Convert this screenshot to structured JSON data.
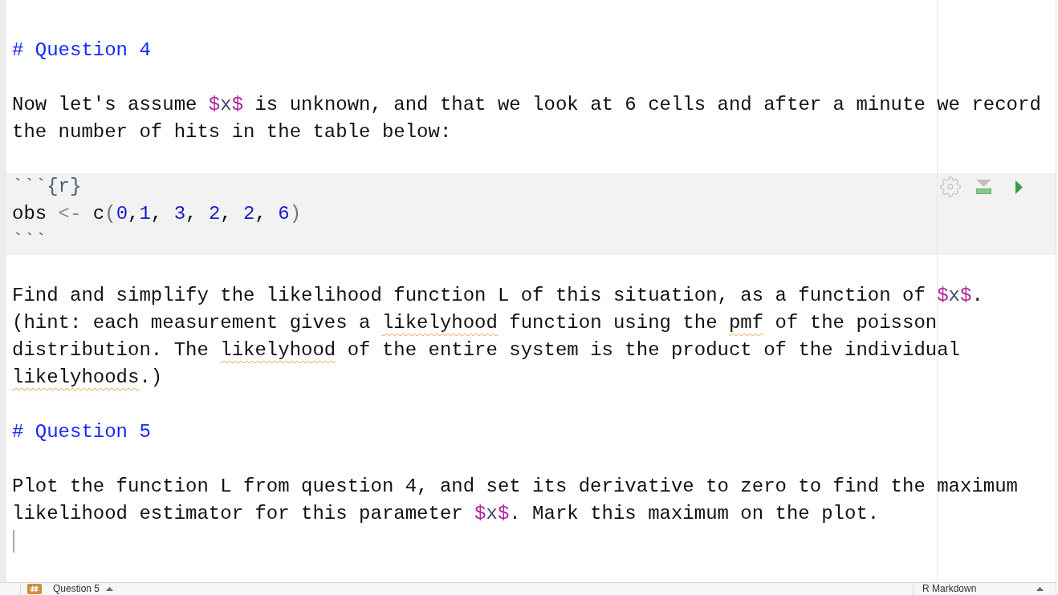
{
  "editor": {
    "blocks": [
      {
        "kind": "heading",
        "text": "# Question 4"
      },
      {
        "kind": "paragraph",
        "segments": [
          {
            "text": "Now let's assume ",
            "kind": "plain"
          },
          {
            "text": "$",
            "kind": "math_delimiter"
          },
          {
            "text": "x",
            "kind": "math"
          },
          {
            "text": "$",
            "kind": "math_delimiter"
          },
          {
            "text": " is unknown, and that we look at 6 cells and after a minute we record the number of hits in the table below:",
            "kind": "plain"
          }
        ]
      },
      {
        "kind": "code_chunk",
        "lines": [
          [
            {
              "text": "```",
              "kind": "fence"
            },
            {
              "text": "{r}",
              "kind": "chunk_header"
            }
          ],
          [
            {
              "text": "obs ",
              "kind": "identifier"
            },
            {
              "text": "<-",
              "kind": "operator"
            },
            {
              "text": " c",
              "kind": "identifier"
            },
            {
              "text": "(",
              "kind": "paren"
            },
            {
              "text": "0",
              "kind": "number"
            },
            {
              "text": ",",
              "kind": "punctuation"
            },
            {
              "text": "1",
              "kind": "number"
            },
            {
              "text": ", ",
              "kind": "punctuation"
            },
            {
              "text": "3",
              "kind": "number"
            },
            {
              "text": ", ",
              "kind": "punctuation"
            },
            {
              "text": "2",
              "kind": "number"
            },
            {
              "text": ", ",
              "kind": "punctuation"
            },
            {
              "text": "2",
              "kind": "number"
            },
            {
              "text": ", ",
              "kind": "punctuation"
            },
            {
              "text": "6",
              "kind": "number"
            },
            {
              "text": ")",
              "kind": "paren"
            }
          ],
          [
            {
              "text": "```",
              "kind": "fence"
            }
          ]
        ]
      },
      {
        "kind": "paragraph",
        "segments": [
          {
            "text": "Find and simplify the likelihood function L of this situation, as a function of ",
            "kind": "plain"
          },
          {
            "text": "$",
            "kind": "math_delimiter"
          },
          {
            "text": "x",
            "kind": "math"
          },
          {
            "text": "$",
            "kind": "math_delimiter"
          },
          {
            "text": ". (hint: each measurement gives a ",
            "kind": "plain"
          },
          {
            "text": "likelyhood",
            "kind": "misspelled"
          },
          {
            "text": " function using the ",
            "kind": "plain"
          },
          {
            "text": "pmf",
            "kind": "misspelled"
          },
          {
            "text": " of the poisson distribution. The ",
            "kind": "plain"
          },
          {
            "text": "likelyhood",
            "kind": "misspelled"
          },
          {
            "text": " of the entire system is the product of the individual ",
            "kind": "plain"
          },
          {
            "text": "likelyhoods",
            "kind": "misspelled"
          },
          {
            "text": ".)",
            "kind": "plain"
          }
        ]
      },
      {
        "kind": "heading",
        "text": "# Question 5"
      },
      {
        "kind": "paragraph",
        "segments": [
          {
            "text": "Plot the function L from question 4, and set its derivative to zero to find the maximum likelihood estimator for this parameter ",
            "kind": "plain"
          },
          {
            "text": "$",
            "kind": "math_delimiter"
          },
          {
            "text": "x",
            "kind": "math"
          },
          {
            "text": "$",
            "kind": "math_delimiter"
          },
          {
            "text": ". Mark this maximum on the plot.",
            "kind": "plain"
          }
        ]
      },
      {
        "kind": "empty_line",
        "cursor": true
      }
    ]
  },
  "status_bar": {
    "section": "Question 5",
    "file_type": "R Markdown"
  }
}
